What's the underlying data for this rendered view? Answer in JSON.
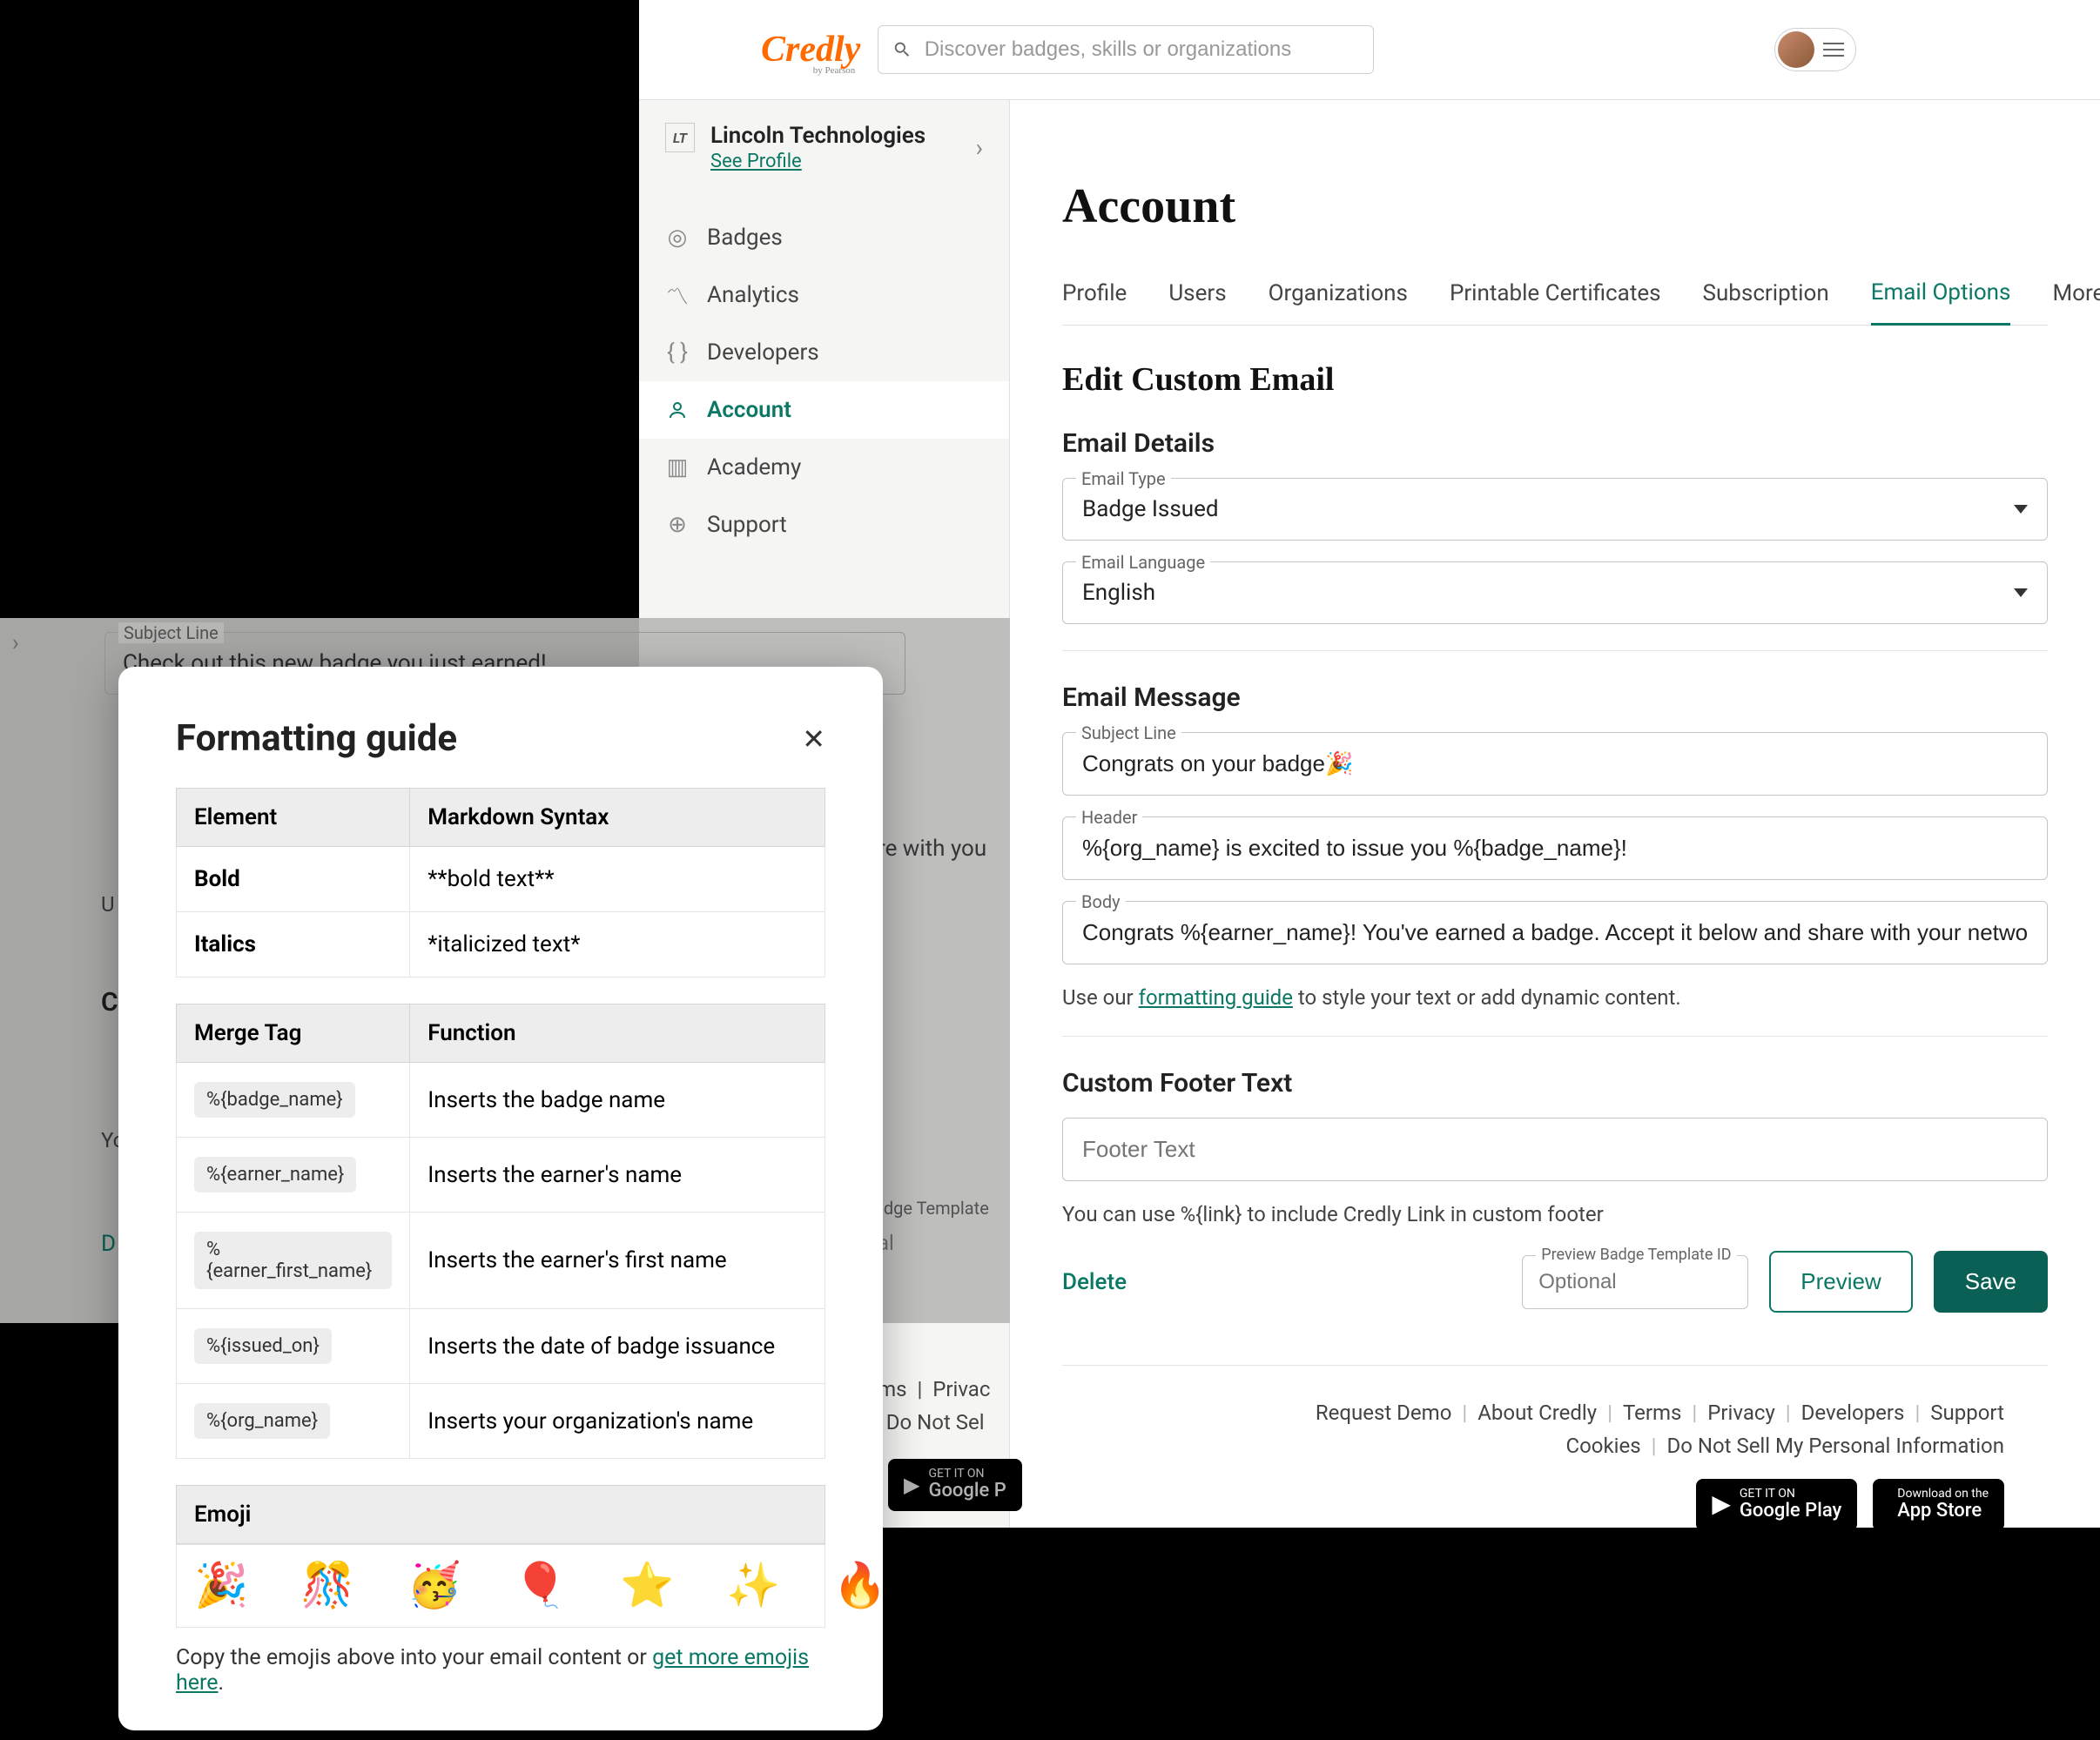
{
  "brand": "Credly",
  "search": {
    "placeholder": "Discover badges, skills or organizations"
  },
  "org": {
    "name": "Lincoln Technologies",
    "see_profile": "See Profile"
  },
  "sidebar": {
    "items": [
      {
        "label": "Badges"
      },
      {
        "label": "Analytics"
      },
      {
        "label": "Developers"
      },
      {
        "label": "Account"
      },
      {
        "label": "Academy"
      },
      {
        "label": "Support"
      }
    ]
  },
  "page_title": "Account",
  "tabs": {
    "items": [
      "Profile",
      "Users",
      "Organizations",
      "Printable Certificates",
      "Subscription",
      "Email Options"
    ],
    "more": "More"
  },
  "section_title": "Edit Custom Email",
  "email_details": {
    "heading": "Email Details",
    "type_label": "Email Type",
    "type_value": "Badge Issued",
    "lang_label": "Email Language",
    "lang_value": "English"
  },
  "email_message": {
    "heading": "Email Message",
    "subject_label": "Subject Line",
    "subject_value": "Congrats on your badge🎉",
    "header_label": "Header",
    "header_value": "%{org_name} is excited to issue you %{badge_name}!",
    "body_label": "Body",
    "body_value": "Congrats %{earner_name}! You've earned a badge. Accept it below and share with your network.",
    "helper_prefix": "Use our ",
    "helper_link": "formatting guide",
    "helper_suffix": " to style your text or add dynamic content."
  },
  "footer_text": {
    "heading": "Custom Footer Text",
    "placeholder": "Footer Text",
    "helper": "You can use %{link} to include Credly Link in custom footer"
  },
  "actions": {
    "delete": "Delete",
    "preview_label": "Preview Badge Template ID",
    "preview_placeholder": "Optional",
    "preview": "Preview",
    "save": "Save"
  },
  "footer_links": [
    "Request Demo",
    "About Credly",
    "Terms",
    "Privacy",
    "Developers",
    "Support",
    "Cookies",
    "Do Not Sell My Personal Information"
  ],
  "store": {
    "google_small": "GET IT ON",
    "google_big": "Google Play",
    "apple_small": "Download on the",
    "apple_big": "App Store"
  },
  "bg": {
    "subject_label": "Subject Line",
    "subject_value": "Check out this new badge you just earned!",
    "body_frag": "re with you",
    "helper_prefix": "U",
    "custom_heading_frag": "C",
    "y_frag": "Yo",
    "d_frag": "D",
    "badge_template_frag": "adge Template",
    "al_frag": "al",
    "footer_terms": "rms",
    "footer_priv": "Privac",
    "footer_dns": "Do Not Sel",
    "store_small": "GET IT ON",
    "store_big": "Google P"
  },
  "modal": {
    "title": "Formatting guide",
    "markup_headers": [
      "Element",
      "Markdown Syntax"
    ],
    "markup_rows": [
      {
        "element": "Bold",
        "syntax": "**bold text**"
      },
      {
        "element": "Italics",
        "syntax": "*italicized text*"
      }
    ],
    "merge_headers": [
      "Merge Tag",
      "Function"
    ],
    "merge_rows": [
      {
        "tag": "%{badge_name}",
        "fn": "Inserts the badge name"
      },
      {
        "tag": "%{earner_name}",
        "fn": "Inserts the earner's name"
      },
      {
        "tag": "%{earner_first_name}",
        "fn": "Inserts the earner's first name"
      },
      {
        "tag": "%{issued_on}",
        "fn": "Inserts the date of badge issuance"
      },
      {
        "tag": "%{org_name}",
        "fn": "Inserts your organization's name"
      }
    ],
    "emoji_header": "Emoji",
    "emojis": [
      "🎉",
      "🎊",
      "🥳",
      "🎈",
      "⭐",
      "✨",
      "🔥"
    ],
    "emoji_help_prefix": "Copy the emojis above into your email content or ",
    "emoji_help_link": "get more emojis here",
    "emoji_help_suffix": "."
  }
}
